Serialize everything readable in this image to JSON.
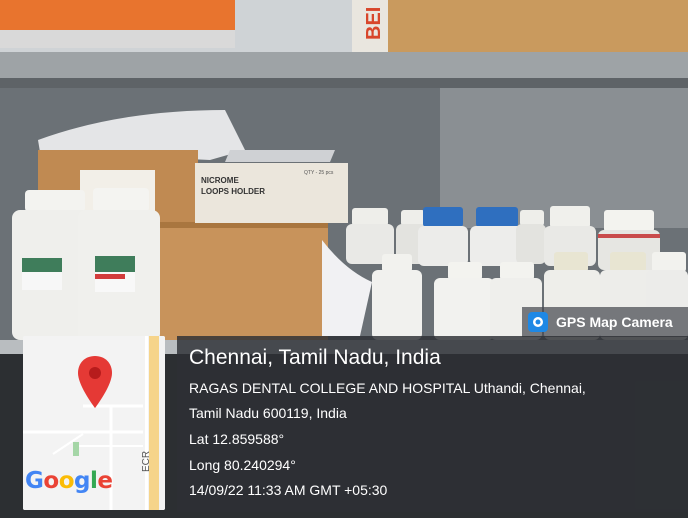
{
  "image": {
    "scene": "laboratory shelf with culture media bottles and cardboard boxes",
    "labels": {
      "box_top": "BEI",
      "loops_box_line1": "NICROME",
      "loops_box_line2": "LOOPS HOLDER",
      "loops_box_qty": "QTY - 25 pcs"
    }
  },
  "app_badge": {
    "label": "GPS Map Camera",
    "icon": "gps-map-camera-icon"
  },
  "location": {
    "title": "Chennai, Tamil Nadu, India",
    "address_line1": "RAGAS DENTAL COLLEGE AND HOSPITAL Uthandi, Chennai,",
    "address_line2": "Tamil Nadu 600119, India",
    "lat": "Lat 12.859588°",
    "long": "Long 80.240294°",
    "datetime": "14/09/22 11:33 AM GMT +05:30"
  },
  "mini_map": {
    "logo_text": "Google",
    "road_label": "ECR",
    "pin_icon": "map-pin-icon",
    "colors": {
      "pin": "#e53935",
      "road_yellow": "#f6d48a",
      "google_blue": "#4285F4",
      "google_red": "#EA4335",
      "google_yellow": "#FBBC05",
      "google_green": "#34A853"
    }
  }
}
